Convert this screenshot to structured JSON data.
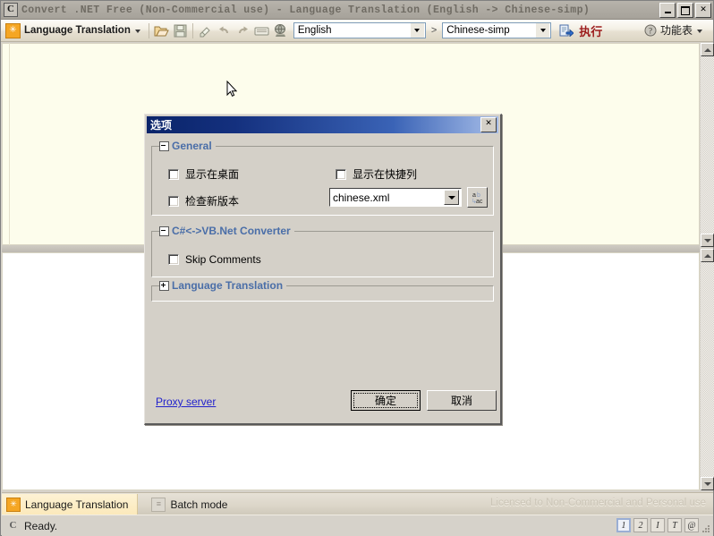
{
  "window": {
    "title": "Convert .NET Free (Non-Commercial use) - Language Translation (English -> Chinese-simp)",
    "app_icon": "C",
    "buttons": {
      "minimize": "minimize-icon",
      "maximize": "maximize-icon",
      "close": "close-icon"
    }
  },
  "toolbar": {
    "mode_label": "Language Translation",
    "mode_icon": "translate-app-icon",
    "icons": [
      "open-folder-icon",
      "save-disk-icon",
      "eraser-icon",
      "undo-icon",
      "redo-icon",
      "keyboard-icon",
      "globe-icon"
    ],
    "source_language": "English",
    "source_placeholder": "English",
    "arrow": ">",
    "target_language": "Chinese-simp",
    "target_placeholder": "Chinese-simp",
    "execute_label": "执行",
    "execute_icon": "execute-arrow-icon",
    "menu_label": "功能表",
    "menu_icon": "help-circle-icon"
  },
  "dialog": {
    "title": "选项",
    "close_label": "✕",
    "groups": [
      {
        "name": "general",
        "title": "General",
        "expander": "minus",
        "checkboxes": [
          {
            "label": "显示在桌面",
            "checked": false
          },
          {
            "label": "显示在快捷列",
            "checked": false
          },
          {
            "label": "检查新版本",
            "checked": false
          }
        ],
        "combo": {
          "value": "chinese.xml",
          "placeholder": "chinese.xml"
        },
        "abc_button": "spellcheck-abc-icon"
      },
      {
        "name": "csharp-vbnet-converter",
        "title": "C#<->VB.Net Converter",
        "expander": "minus",
        "checkboxes": [
          {
            "label": "Skip Comments",
            "checked": false
          }
        ]
      },
      {
        "name": "language-translation",
        "title": "Language Translation",
        "expander": "plus",
        "checkboxes": []
      }
    ],
    "proxy_link": "Proxy server",
    "ok_label": "确定",
    "cancel_label": "取消"
  },
  "tabs": [
    {
      "label": "Language Translation",
      "icon": "translate-app-icon",
      "active": true
    },
    {
      "label": "Batch mode",
      "icon": "batch-mode-icon",
      "active": false
    }
  ],
  "license_text": "Licensed to Non-Commercial and Personal use",
  "statusbar": {
    "icon": "app-c-icon",
    "text": "Ready.",
    "buttons": [
      {
        "label": "1",
        "selected": true
      },
      {
        "label": "2",
        "selected": false
      },
      {
        "label": "I",
        "selected": false
      },
      {
        "label": "T",
        "selected": false
      },
      {
        "label": "@",
        "selected": false
      }
    ]
  },
  "colors": {
    "title_inactive": "#6f6b63",
    "dialog_title_start": "#0a246a",
    "dialog_title_end": "#a6bde8",
    "group_title": "#4a6ea8",
    "execute_red": "#9c1b1b",
    "link_blue": "#2222cc",
    "editor_background": "#fdfdec",
    "accent_orange": "#f5a623"
  }
}
